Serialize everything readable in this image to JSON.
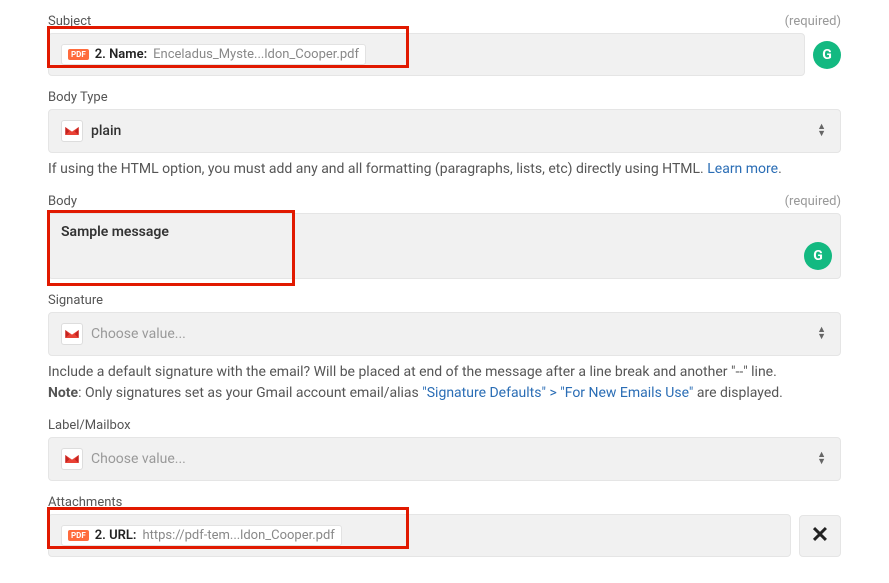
{
  "labels": {
    "subject": "Subject",
    "bodyType": "Body Type",
    "body": "Body",
    "signature": "Signature",
    "labelMailbox": "Label/Mailbox",
    "attachments": "Attachments",
    "required": "(required)"
  },
  "subject": {
    "pill_badge": "PDF",
    "pill_prefix": "2. Name:",
    "pill_value": "Enceladus_Myste...ldon_Cooper.pdf"
  },
  "bodyType": {
    "value": "plain",
    "helper_pre": "If using the HTML option, you must add any and all formatting (paragraphs, lists, etc) directly using HTML. ",
    "helper_link": "Learn more"
  },
  "body": {
    "value": "Sample message"
  },
  "signature": {
    "placeholder": "Choose value...",
    "helper_line1": "Include a default signature with the email? Will be placed at end of the message after a line break and another \"--\" line.",
    "helper_line2_a": "Note",
    "helper_line2_b": ": Only signatures set as your Gmail account email/alias ",
    "helper_line2_c": "\"Signature Defaults\" > \"For New Emails Use\"",
    "helper_line2_d": " are displayed."
  },
  "labelMailbox": {
    "placeholder": "Choose value..."
  },
  "attachments": {
    "pill_badge": "PDF",
    "pill_prefix": "2. URL:",
    "pill_value": "https://pdf-tem...ldon_Cooper.pdf"
  },
  "icons": {
    "grammarly": "G",
    "close": "✕"
  }
}
